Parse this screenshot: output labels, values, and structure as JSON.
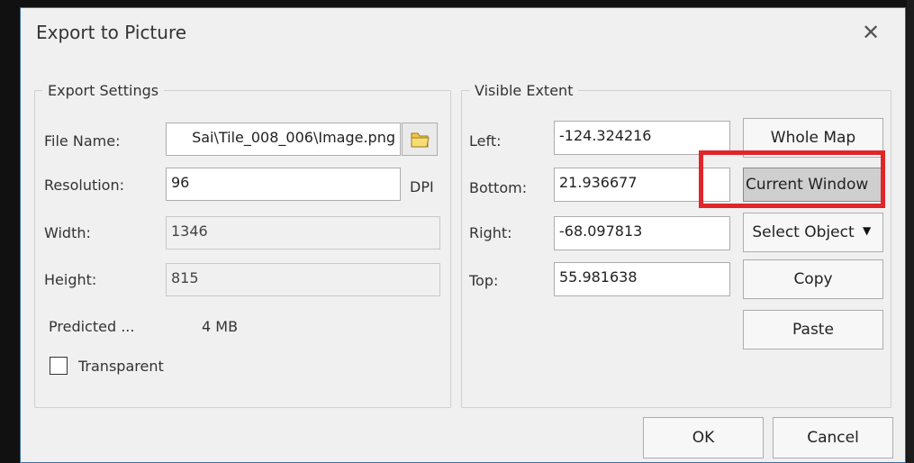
{
  "dialog": {
    "title": "Export to Picture"
  },
  "export_settings": {
    "legend": "Export Settings",
    "file_name_label": "File Name:",
    "file_name_value": "Sai\\Tile_008_006\\Image.png",
    "resolution_label": "Resolution:",
    "resolution_value": "96",
    "resolution_unit": "DPI",
    "width_label": "Width:",
    "width_value": "1346",
    "height_label": "Height:",
    "height_value": "815",
    "predicted_label": "Predicted ...",
    "predicted_value": "4 MB",
    "transparent_label": "Transparent",
    "transparent_checked": false
  },
  "visible_extent": {
    "legend": "Visible Extent",
    "left_label": "Left:",
    "left_value": "-124.324216",
    "bottom_label": "Bottom:",
    "bottom_value": "21.936677",
    "right_label": "Right:",
    "right_value": "-68.097813",
    "top_label": "Top:",
    "top_value": "55.981638",
    "buttons": {
      "whole_map": "Whole Map",
      "current_window": "Current Window",
      "select_object": "Select Object",
      "copy": "Copy",
      "paste": "Paste"
    }
  },
  "footer": {
    "ok": "OK",
    "cancel": "Cancel"
  },
  "colors": {
    "highlight": "#e0262a",
    "dialog_bg": "#f0f0f0"
  }
}
